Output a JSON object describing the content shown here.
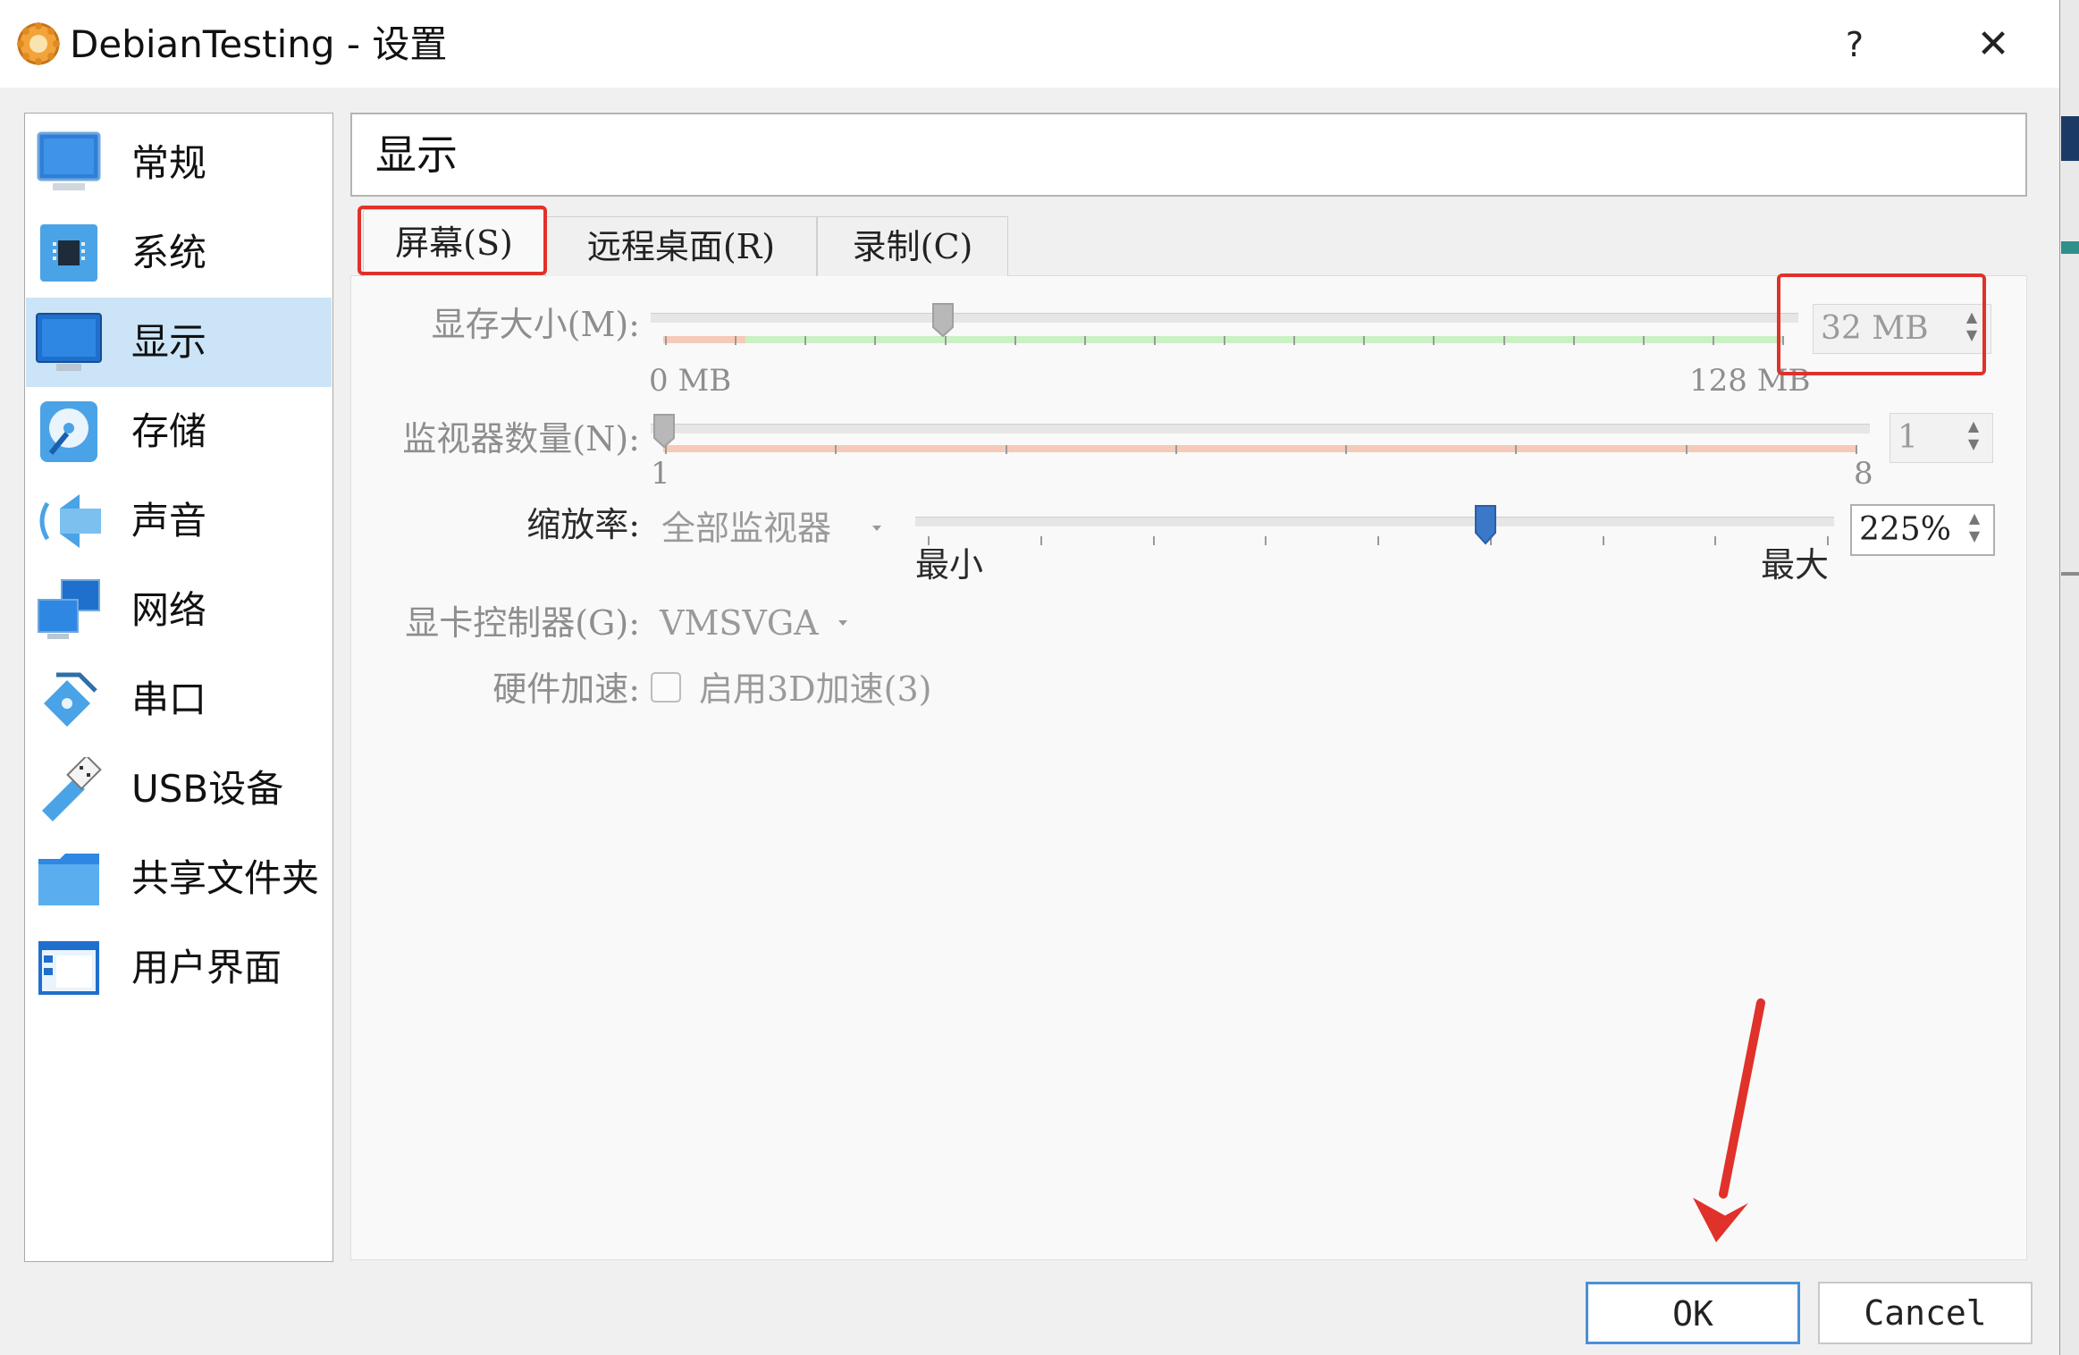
{
  "window": {
    "title": "DebianTesting - 设置",
    "help_label": "?",
    "close_label": "✕"
  },
  "sidebar": {
    "items": [
      {
        "label": "常规",
        "icon": "monitor-general-icon"
      },
      {
        "label": "系统",
        "icon": "chip-icon"
      },
      {
        "label": "显示",
        "icon": "display-icon",
        "selected": true
      },
      {
        "label": "存储",
        "icon": "disk-icon"
      },
      {
        "label": "声音",
        "icon": "speaker-icon"
      },
      {
        "label": "网络",
        "icon": "network-icon"
      },
      {
        "label": "串口",
        "icon": "serial-port-icon"
      },
      {
        "label": "USB设备",
        "icon": "usb-icon"
      },
      {
        "label": "共享文件夹",
        "icon": "folder-icon"
      },
      {
        "label": "用户界面",
        "icon": "window-ui-icon"
      }
    ]
  },
  "header": {
    "title": "显示"
  },
  "tabs": [
    {
      "label": "屏幕(S)",
      "active": true
    },
    {
      "label": "远程桌面(R)"
    },
    {
      "label": "录制(C)"
    }
  ],
  "screen": {
    "video_memory": {
      "label": "显存大小(M):",
      "value": "32 MB",
      "value_mb": 32,
      "min_label": "0 MB",
      "max_label": "128 MB",
      "min_mb": 0,
      "max_mb": 128
    },
    "monitors": {
      "label": "监视器数量(N):",
      "value": "1",
      "min_label": "1",
      "max_label": "8"
    },
    "scale": {
      "label": "缩放率:",
      "combo_value": "全部监视器",
      "value": "225%",
      "position_fraction": 0.62,
      "min_label": "最小",
      "max_label": "最大"
    },
    "graphics_controller": {
      "label": "显卡控制器(G):",
      "value": "VMSVGA"
    },
    "acceleration": {
      "label": "硬件加速:",
      "checkbox_label": "启用3D加速(3)",
      "checked": false
    }
  },
  "buttons": {
    "ok": "OK",
    "cancel": "Cancel"
  },
  "colors": {
    "selection": "#cce4f7",
    "highlight_red": "#e0312a",
    "accent_blue": "#3b78c9"
  }
}
